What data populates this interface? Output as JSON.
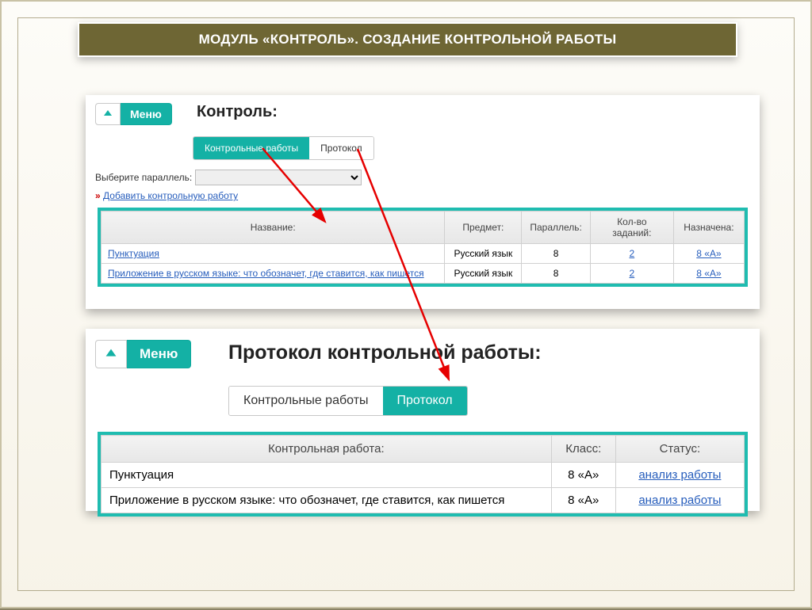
{
  "slide_title": "МОДУЛЬ «КОНТРОЛЬ». СОЗДАНИЕ КОНТРОЛЬНОЙ РАБОТЫ",
  "menu_label": "Меню",
  "panel_a": {
    "heading": "Контроль:",
    "tabs": {
      "works": "Контрольные работы",
      "protocol": "Протокол"
    },
    "select_label": "Выберите параллель:",
    "add_link": "Добавить контрольную работу",
    "add_raq": "»",
    "cols": {
      "name": "Название:",
      "subj": "Предмет:",
      "par": "Параллель:",
      "cnt": "Кол-во заданий:",
      "asg": "Назначена:"
    },
    "rows": [
      {
        "name": "Пунктуация",
        "subj": "Русский язык",
        "par": "8",
        "cnt": "2",
        "asg": "8 «А»"
      },
      {
        "name": "Приложение в русском языке: что обозначет, где ставится, как пишется",
        "subj": "Русский язык",
        "par": "8",
        "cnt": "2",
        "asg": "8 «А»"
      }
    ]
  },
  "panel_b": {
    "heading": "Протокол контрольной работы:",
    "tabs": {
      "works": "Контрольные работы",
      "protocol": "Протокол"
    },
    "cols": {
      "name": "Контрольная работа:",
      "class": "Класс:",
      "status": "Статус:"
    },
    "status_link": "анализ работы",
    "rows": [
      {
        "name": "Пунктуация",
        "class": "8 «А»"
      },
      {
        "name": "Приложение в русском языке: что обозначет, где ставится, как пишется",
        "class": "8 «А»"
      }
    ]
  }
}
